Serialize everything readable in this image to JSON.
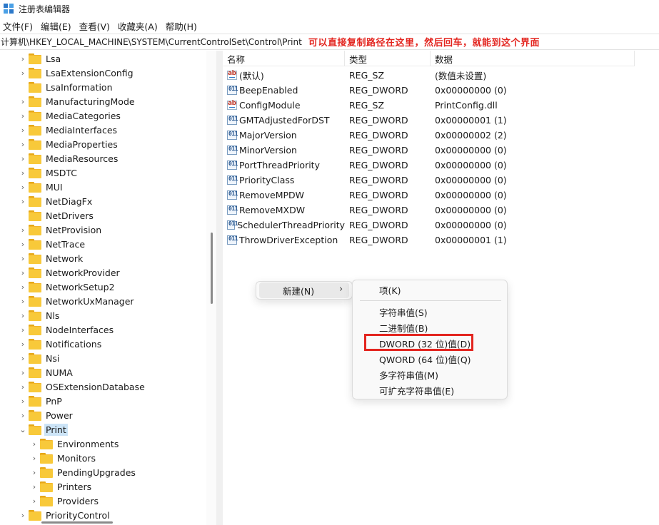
{
  "window": {
    "title": "注册表编辑器"
  },
  "menu": [
    "文件(F)",
    "编辑(E)",
    "查看(V)",
    "收藏夹(A)",
    "帮助(H)"
  ],
  "address": {
    "path": "计算机\\HKEY_LOCAL_MACHINE\\SYSTEM\\CurrentControlSet\\Control\\Print",
    "annotation": "可以直接复制路径在这里，然后回车，就能到这个界面"
  },
  "tree": [
    {
      "label": "Lsa",
      "level": 1,
      "expand": "collapsed"
    },
    {
      "label": "LsaExtensionConfig",
      "level": 1,
      "expand": "collapsed"
    },
    {
      "label": "LsaInformation",
      "level": 1,
      "expand": "none"
    },
    {
      "label": "ManufacturingMode",
      "level": 1,
      "expand": "collapsed"
    },
    {
      "label": "MediaCategories",
      "level": 1,
      "expand": "collapsed"
    },
    {
      "label": "MediaInterfaces",
      "level": 1,
      "expand": "collapsed"
    },
    {
      "label": "MediaProperties",
      "level": 1,
      "expand": "collapsed"
    },
    {
      "label": "MediaResources",
      "level": 1,
      "expand": "collapsed"
    },
    {
      "label": "MSDTC",
      "level": 1,
      "expand": "collapsed"
    },
    {
      "label": "MUI",
      "level": 1,
      "expand": "collapsed"
    },
    {
      "label": "NetDiagFx",
      "level": 1,
      "expand": "collapsed"
    },
    {
      "label": "NetDrivers",
      "level": 1,
      "expand": "none"
    },
    {
      "label": "NetProvision",
      "level": 1,
      "expand": "collapsed"
    },
    {
      "label": "NetTrace",
      "level": 1,
      "expand": "collapsed"
    },
    {
      "label": "Network",
      "level": 1,
      "expand": "collapsed"
    },
    {
      "label": "NetworkProvider",
      "level": 1,
      "expand": "collapsed"
    },
    {
      "label": "NetworkSetup2",
      "level": 1,
      "expand": "collapsed"
    },
    {
      "label": "NetworkUxManager",
      "level": 1,
      "expand": "collapsed"
    },
    {
      "label": "Nls",
      "level": 1,
      "expand": "collapsed"
    },
    {
      "label": "NodeInterfaces",
      "level": 1,
      "expand": "collapsed"
    },
    {
      "label": "Notifications",
      "level": 1,
      "expand": "collapsed"
    },
    {
      "label": "Nsi",
      "level": 1,
      "expand": "collapsed"
    },
    {
      "label": "NUMA",
      "level": 1,
      "expand": "collapsed"
    },
    {
      "label": "OSExtensionDatabase",
      "level": 1,
      "expand": "collapsed"
    },
    {
      "label": "PnP",
      "level": 1,
      "expand": "collapsed"
    },
    {
      "label": "Power",
      "level": 1,
      "expand": "collapsed"
    },
    {
      "label": "Print",
      "level": 1,
      "expand": "expanded",
      "selected": true
    },
    {
      "label": "Environments",
      "level": 2,
      "expand": "collapsed"
    },
    {
      "label": "Monitors",
      "level": 2,
      "expand": "collapsed"
    },
    {
      "label": "PendingUpgrades",
      "level": 2,
      "expand": "collapsed"
    },
    {
      "label": "Printers",
      "level": 2,
      "expand": "collapsed"
    },
    {
      "label": "Providers",
      "level": 2,
      "expand": "collapsed"
    },
    {
      "label": "PriorityControl",
      "level": 1,
      "expand": "collapsed"
    }
  ],
  "list": {
    "columns": [
      "名称",
      "类型",
      "数据"
    ],
    "rows": [
      {
        "name": "(默认)",
        "type": "REG_SZ",
        "data": "(数值未设置)",
        "icon": "string-value-icon"
      },
      {
        "name": "BeepEnabled",
        "type": "REG_DWORD",
        "data": "0x00000000 (0)",
        "icon": "binary-value-icon"
      },
      {
        "name": "ConfigModule",
        "type": "REG_SZ",
        "data": "PrintConfig.dll",
        "icon": "string-value-icon"
      },
      {
        "name": "GMTAdjustedForDST",
        "type": "REG_DWORD",
        "data": "0x00000001 (1)",
        "icon": "binary-value-icon"
      },
      {
        "name": "MajorVersion",
        "type": "REG_DWORD",
        "data": "0x00000002 (2)",
        "icon": "binary-value-icon"
      },
      {
        "name": "MinorVersion",
        "type": "REG_DWORD",
        "data": "0x00000000 (0)",
        "icon": "binary-value-icon"
      },
      {
        "name": "PortThreadPriority",
        "type": "REG_DWORD",
        "data": "0x00000000 (0)",
        "icon": "binary-value-icon"
      },
      {
        "name": "PriorityClass",
        "type": "REG_DWORD",
        "data": "0x00000000 (0)",
        "icon": "binary-value-icon"
      },
      {
        "name": "RemoveMPDW",
        "type": "REG_DWORD",
        "data": "0x00000000 (0)",
        "icon": "binary-value-icon"
      },
      {
        "name": "RemoveMXDW",
        "type": "REG_DWORD",
        "data": "0x00000000 (0)",
        "icon": "binary-value-icon"
      },
      {
        "name": "SchedulerThreadPriority",
        "type": "REG_DWORD",
        "data": "0x00000000 (0)",
        "icon": "binary-value-icon"
      },
      {
        "name": "ThrowDriverException",
        "type": "REG_DWORD",
        "data": "0x00000001 (1)",
        "icon": "binary-value-icon"
      }
    ]
  },
  "context_menu": {
    "new_label": "新建(N)",
    "submenu": [
      "项(K)",
      "字符串值(S)",
      "二进制值(B)",
      "DWORD (32 位)值(D)",
      "QWORD (64 位)值(Q)",
      "多字符串值(M)",
      "可扩充字符串值(E)"
    ],
    "highlighted_index": 3,
    "highlight_color": "#e3251f"
  },
  "icons": {
    "sz": "ab",
    "dword": "011"
  }
}
